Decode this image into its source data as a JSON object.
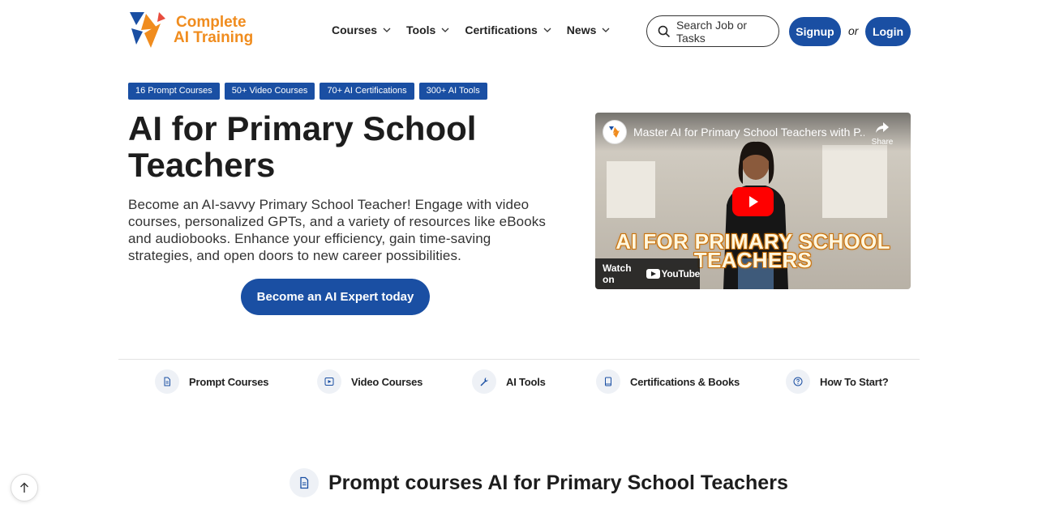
{
  "header": {
    "logo": {
      "line1": "Complete",
      "line2": "AI Training"
    },
    "nav": [
      {
        "label": "Courses"
      },
      {
        "label": "Tools"
      },
      {
        "label": "Certifications"
      },
      {
        "label": "News"
      }
    ],
    "search_placeholder": "Search Job or Tasks",
    "signup": "Signup",
    "or": "or",
    "login": "Login"
  },
  "badges": [
    "16 Prompt Courses",
    "50+ Video Courses",
    "70+ AI Certifications",
    "300+ AI Tools"
  ],
  "hero": {
    "title": "AI for Primary School Teachers",
    "description": "Become an AI-savvy Primary School Teacher! Engage with video courses, personalized GPTs, and a variety of resources like eBooks and audiobooks. Enhance your efficiency, gain time-saving strategies, and open doors to new career possibilities.",
    "cta": "Become an AI Expert today"
  },
  "video": {
    "title": "Master AI for Primary School Teachers with P...",
    "share": "Share",
    "overlay_line1": "AI FOR PRIMARY SCHOOL",
    "overlay_line2": "TEACHERS",
    "watch_on": "Watch on",
    "youtube": "YouTube"
  },
  "quick_links": [
    {
      "label": "Prompt Courses",
      "icon": "document-icon"
    },
    {
      "label": "Video Courses",
      "icon": "play-icon"
    },
    {
      "label": "AI Tools",
      "icon": "wrench-icon"
    },
    {
      "label": "Certifications & Books",
      "icon": "book-icon"
    },
    {
      "label": "How To Start?",
      "icon": "question-icon"
    }
  ],
  "section": {
    "title": "Prompt courses AI for Primary School Teachers",
    "icon": "document-icon"
  },
  "colors": {
    "primary": "#1a4fa3",
    "logo_orange": "#f08c1e",
    "youtube_red": "#ff0000"
  }
}
